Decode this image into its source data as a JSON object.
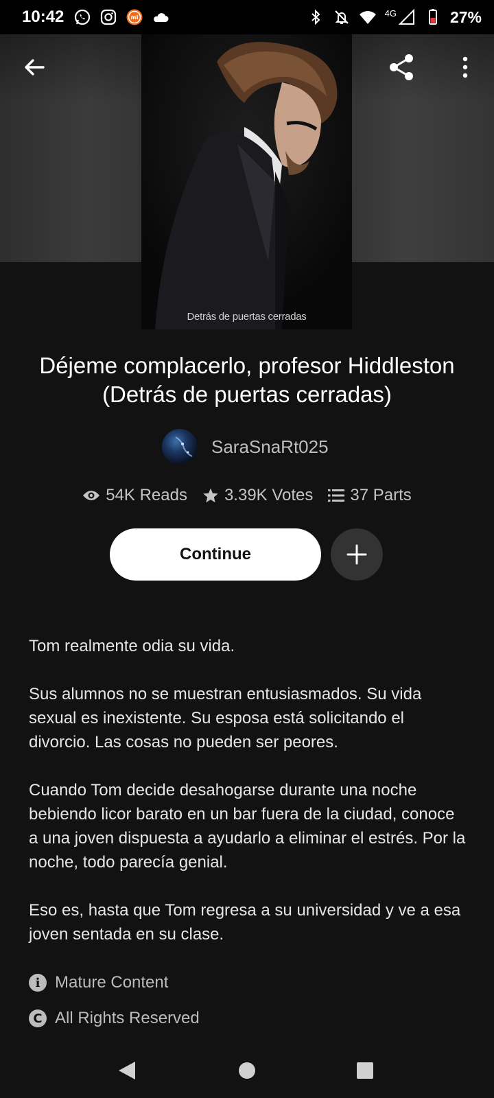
{
  "status_bar": {
    "time": "10:42",
    "battery": "27%",
    "network": "4G",
    "left_icons": [
      "whatsapp-icon",
      "instagram-icon",
      "mi-icon",
      "cloud-icon"
    ],
    "right_icons": [
      "bluetooth-icon",
      "mute-icon",
      "wifi-icon",
      "signal-icon",
      "battery-icon"
    ]
  },
  "toolbar": {
    "back_icon": "arrow-left-icon",
    "share_icon": "share-icon",
    "more_icon": "more-vertical-icon"
  },
  "story": {
    "cover_caption": "Detrás de puertas cerradas",
    "title": "Déjeme complacerlo, profesor Hiddleston (Detrás de puertas cerradas)",
    "author": "SaraSnaRt025",
    "stats": {
      "reads": "54K Reads",
      "votes": "3.39K Votes",
      "parts": "37 Parts"
    },
    "continue_label": "Continue",
    "add_icon": "plus-icon",
    "description": [
      "Tom realmente odia su vida.",
      "Sus alumnos no se muestran entusiasmados. Su vida sexual es inexistente. Su esposa está solicitando el divorcio. Las cosas no pueden ser peores.",
      "Cuando Tom decide desahogarse durante una noche bebiendo licor barato en un bar fuera de la ciudad, conoce a una joven dispuesta a ayudarlo a eliminar el estrés. Por la noche, todo parecía genial.",
      "Eso es, hasta que Tom regresa a su universidad y ve a esa joven sentada en su clase."
    ],
    "mature_label": "Mature Content",
    "rights_label": "All Rights Reserved"
  },
  "colors": {
    "background": "#121212",
    "button_primary": "#ffffff",
    "button_secondary": "#333333",
    "muted_text": "#c4c4c4"
  }
}
